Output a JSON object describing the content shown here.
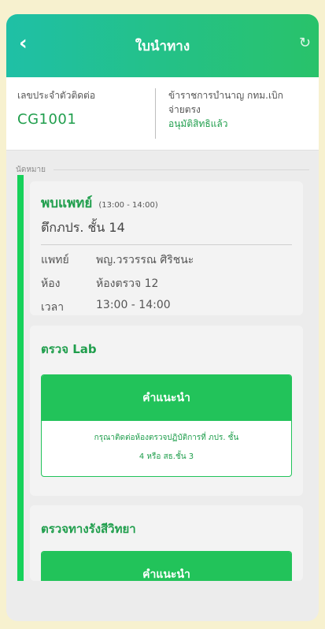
{
  "header": {
    "title": "ใบนำทาง",
    "back_icon": "chevron-left-icon",
    "refresh_icon": "refresh-icon"
  },
  "info": {
    "contact_label": "เลขประจำตัวติดต่อ",
    "contact_code": "CG1001",
    "status_line1": "ข้าราชการบำนาญ กทม.เบิก",
    "status_line2": "จ่ายตรง",
    "status_approved": "อนุมัติสิทธิแล้ว"
  },
  "section": {
    "label": "นัดหมาย"
  },
  "appointment": {
    "title": "พบแพทย์",
    "time_range": "(13:00 - 14:00)",
    "location": "ตึกภปร. ชั้น 14",
    "rows": [
      {
        "key": "แพทย์",
        "value": "พญ.วรวรรณ ศิริชนะ"
      },
      {
        "key": "ห้อง",
        "value": "ห้องตรวจ 12"
      },
      {
        "key": "เวลา",
        "value": "13:00 - 14:00"
      }
    ]
  },
  "lab": {
    "title": "ตรวจ Lab",
    "advice_title": "คำแนะนำ",
    "advice_line1": "กรุณาติดต่อห้องตรวจปฏิบัติการที่ ภปร. ชั้น",
    "advice_line2": "4 หรือ สธ.ชั้น 3"
  },
  "radiology": {
    "title": "ตรวจทางรังสีวิทยา",
    "advice_title": "คำแนะนำ"
  },
  "colors": {
    "accent": "#22c35a",
    "header_start": "#1fc0a6",
    "header_end": "#29c26a"
  }
}
